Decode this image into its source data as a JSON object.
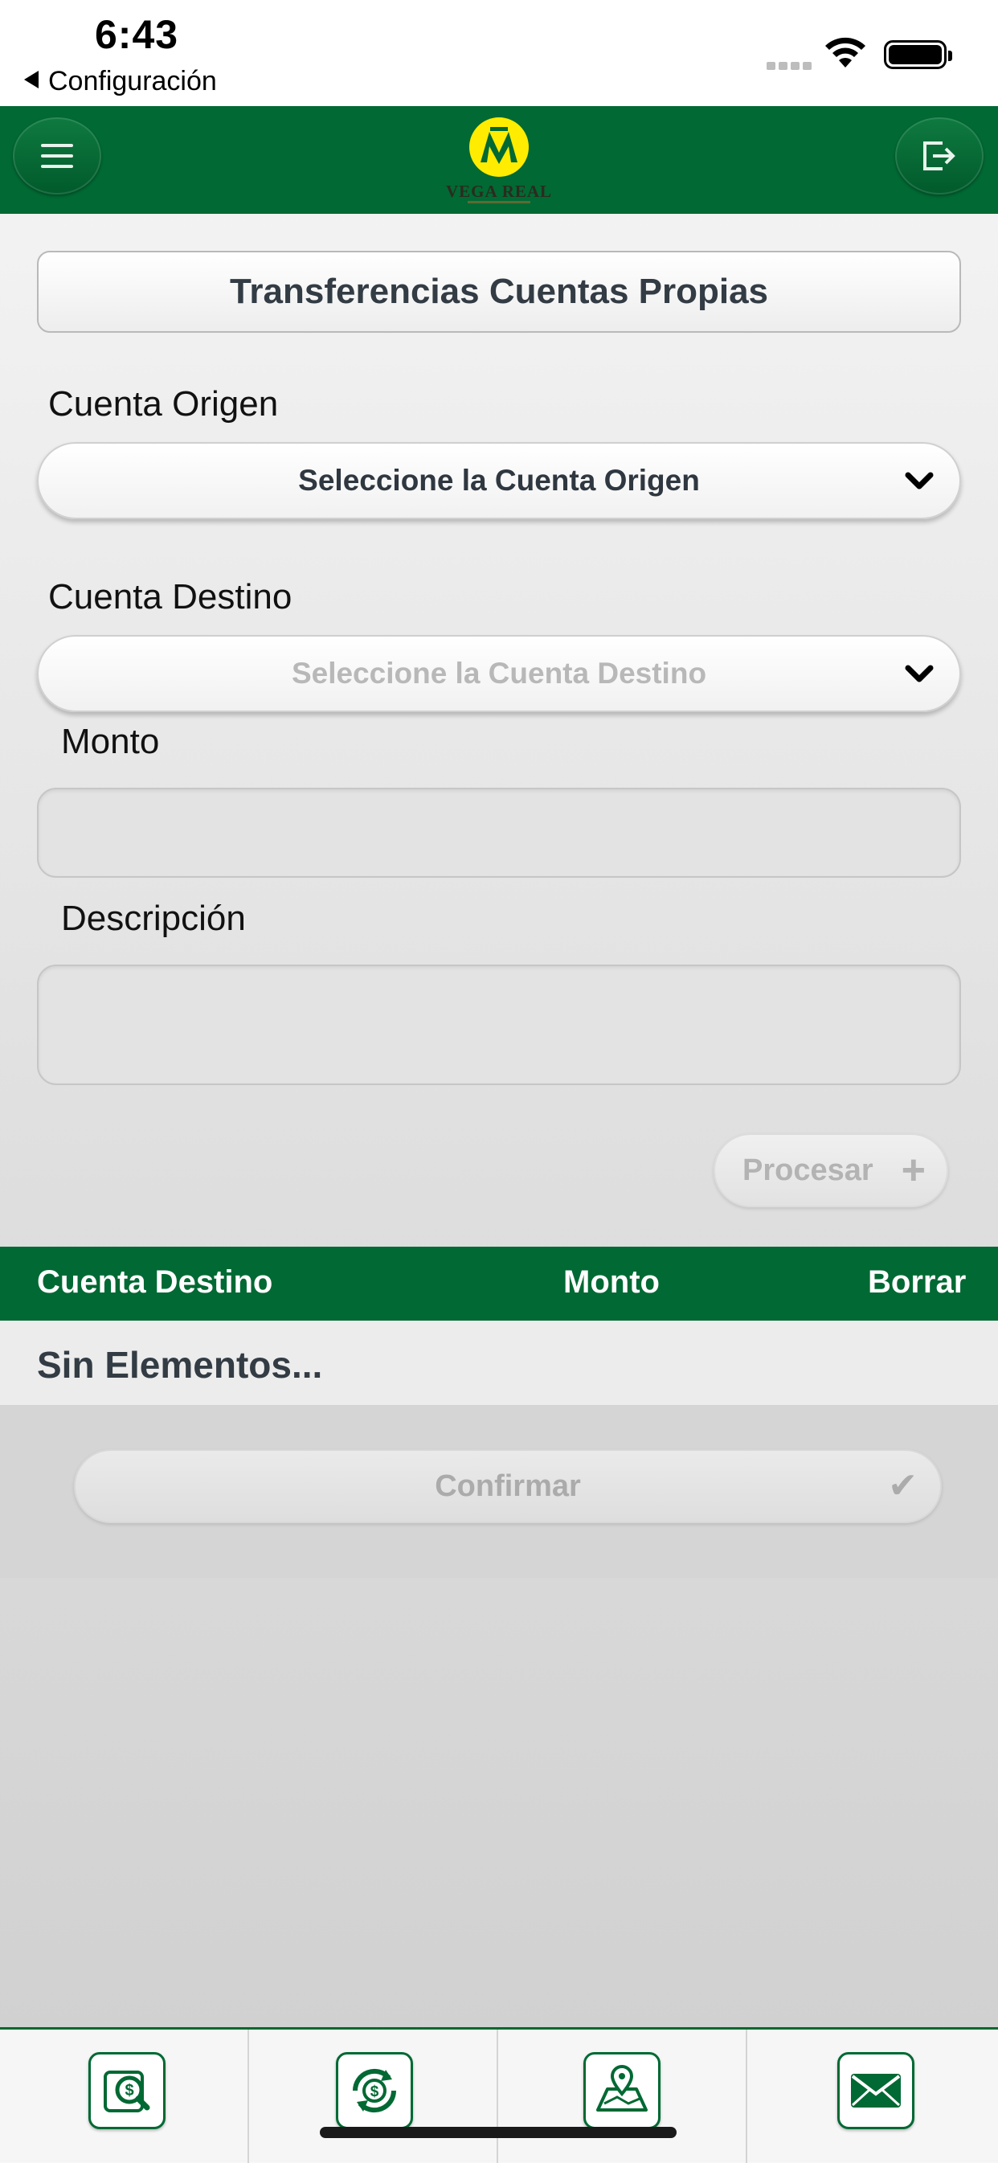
{
  "status_bar": {
    "time": "6:43",
    "back_label": "Configuración"
  },
  "header": {
    "logo_text": "VEGA REAL",
    "menu_icon": "hamburger-icon",
    "logout_icon": "logout-icon"
  },
  "page": {
    "title": "Transferencias Cuentas Propias"
  },
  "form": {
    "origin_label": "Cuenta Origen",
    "origin_selected": "Seleccione la Cuenta Origen",
    "dest_label": "Cuenta Destino",
    "dest_selected": "Seleccione la Cuenta Destino",
    "amount_label": "Monto",
    "amount_value": "",
    "desc_label": "Descripción",
    "desc_value": "",
    "process_label": "Procesar"
  },
  "table": {
    "columns": [
      "Cuenta Destino",
      "Monto",
      "Borrar"
    ],
    "empty_text": "Sin Elementos..."
  },
  "confirm": {
    "label": "Confirmar"
  },
  "colors": {
    "brand_green": "#016933",
    "logo_yellow": "#ffec00",
    "disabled_text": "#b3b3b3"
  },
  "tab_bar": {
    "items": [
      {
        "icon": "account-search-icon"
      },
      {
        "icon": "money-transfer-icon"
      },
      {
        "icon": "map-location-icon"
      },
      {
        "icon": "mail-icon"
      }
    ]
  }
}
